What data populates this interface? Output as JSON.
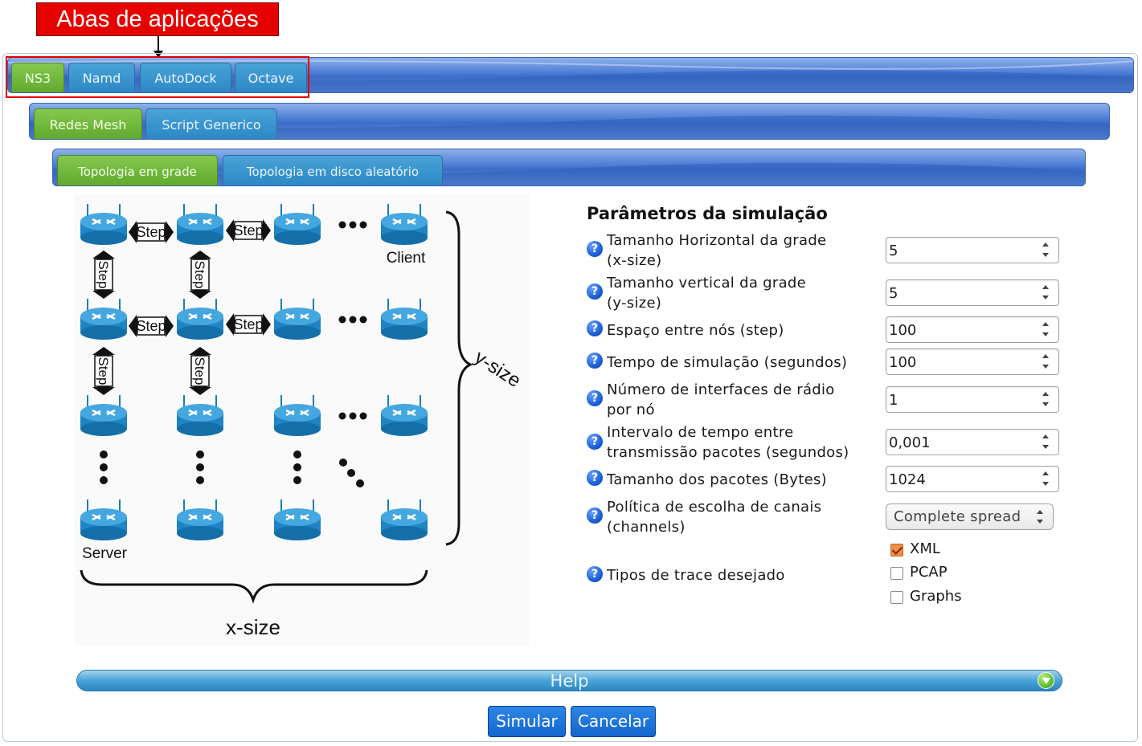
{
  "annotation": {
    "label": "Abas de aplicações"
  },
  "app_tabs": [
    {
      "label": "NS3",
      "active": true
    },
    {
      "label": "Namd",
      "active": false
    },
    {
      "label": "AutoDock",
      "active": false
    },
    {
      "label": "Octave",
      "active": false
    }
  ],
  "sub_tabs": [
    {
      "label": "Redes Mesh",
      "active": true
    },
    {
      "label": "Script Generico",
      "active": false
    }
  ],
  "topology_tabs": [
    {
      "label": "Topologia em grade",
      "active": true
    },
    {
      "label": "Topologia em disco aleatório",
      "active": false
    }
  ],
  "diagram": {
    "step_label": "Step",
    "client_label": "Client",
    "server_label": "Server",
    "x_axis_label": "x-size",
    "y_axis_label": "y-size"
  },
  "form": {
    "title": "Parâmetros da simulação",
    "help_icon_glyph": "?",
    "params": [
      {
        "label_line1": "Tamanho Horizontal da grade",
        "label_line2": "(x-size)",
        "value": "5"
      },
      {
        "label_line1": "Tamanho vertical da grade",
        "label_line2": "(y-size)",
        "value": "5"
      },
      {
        "label_line1": "Espaço entre nós (step)",
        "label_line2": "",
        "value": "100"
      },
      {
        "label_line1": "Tempo de simulação (segundos)",
        "label_line2": "",
        "value": "100"
      },
      {
        "label_line1": "Número de interfaces de rádio",
        "label_line2": "por nó",
        "value": "1"
      },
      {
        "label_line1": "Intervalo de tempo entre",
        "label_line2": "transmissão pacotes (segundos)",
        "value": "0,001"
      },
      {
        "label_line1": "Tamanho dos pacotes (Bytes)",
        "label_line2": "",
        "value": "1024"
      }
    ],
    "channel_policy": {
      "label_line1": "Política de escolha de canais",
      "label_line2": "(channels)",
      "selected": "Complete spread"
    },
    "trace": {
      "label": "Tipos de trace desejado",
      "options": [
        {
          "label": "XML",
          "checked": true
        },
        {
          "label": "PCAP",
          "checked": false
        },
        {
          "label": "Graphs",
          "checked": false
        }
      ]
    }
  },
  "help_bar": {
    "label": "Help"
  },
  "buttons": {
    "simulate": "Simular",
    "cancel": "Cancelar"
  },
  "colors": {
    "active_tab": "#6ab535",
    "inactive_tab": "#2a86c4",
    "tabbar": "#4a7bd4",
    "callout": "#e60000",
    "button": "#1466cc"
  }
}
